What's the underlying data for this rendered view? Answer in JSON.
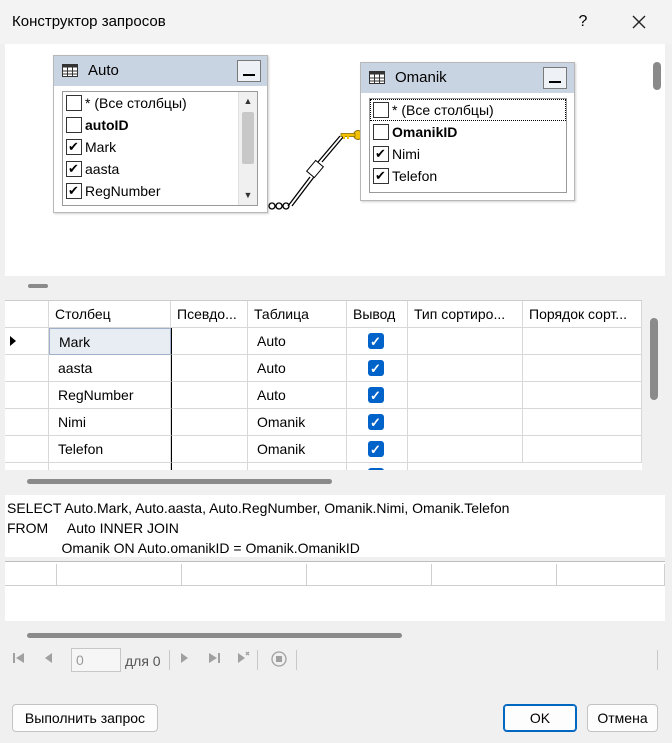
{
  "window": {
    "title": "Конструктор запросов",
    "help_label": "?"
  },
  "diagram": {
    "tables": [
      {
        "name": "Auto",
        "columns": [
          {
            "label": "* (Все столбцы)",
            "checked": false,
            "bold": false
          },
          {
            "label": "autoID",
            "checked": false,
            "bold": true
          },
          {
            "label": "Mark",
            "checked": true,
            "bold": false
          },
          {
            "label": "aasta",
            "checked": true,
            "bold": false
          },
          {
            "label": "RegNumber",
            "checked": true,
            "bold": false
          }
        ]
      },
      {
        "name": "Omanik",
        "columns": [
          {
            "label": "* (Все столбцы)",
            "checked": false,
            "bold": false
          },
          {
            "label": "OmanikID",
            "checked": false,
            "bold": true
          },
          {
            "label": "Nimi",
            "checked": true,
            "bold": false
          },
          {
            "label": "Telefon",
            "checked": true,
            "bold": false
          }
        ]
      }
    ],
    "relation_icon": "key-icon"
  },
  "grid": {
    "headers": [
      "Столбец",
      "Псевдо...",
      "Таблица",
      "Вывод",
      "Тип сортиро...",
      "Порядок сорт..."
    ],
    "rows": [
      {
        "column": "Mark",
        "alias": "",
        "table": "Auto",
        "output": true
      },
      {
        "column": "aasta",
        "alias": "",
        "table": "Auto",
        "output": true
      },
      {
        "column": "RegNumber",
        "alias": "",
        "table": "Auto",
        "output": true
      },
      {
        "column": "Nimi",
        "alias": "",
        "table": "Omanik",
        "output": true
      },
      {
        "column": "Telefon",
        "alias": "",
        "table": "Omanik",
        "output": true
      }
    ]
  },
  "sql": {
    "lines": [
      "SELECT Auto.Mark, Auto.aasta, Auto.RegNumber, Omanik.Nimi, Omanik.Telefon",
      "FROM     Auto INNER JOIN",
      "              Omanik ON Auto.omanikID = Omanik.OmanikID"
    ]
  },
  "navigator": {
    "position": "0",
    "of_label": "для 0"
  },
  "buttons": {
    "execute": "Выполнить запрос",
    "ok": "OK",
    "cancel": "Отмена"
  },
  "colors": {
    "table_header": "#c9d4e2",
    "checkbox_accent": "#0063c9",
    "primary_border": "#0067c0"
  }
}
